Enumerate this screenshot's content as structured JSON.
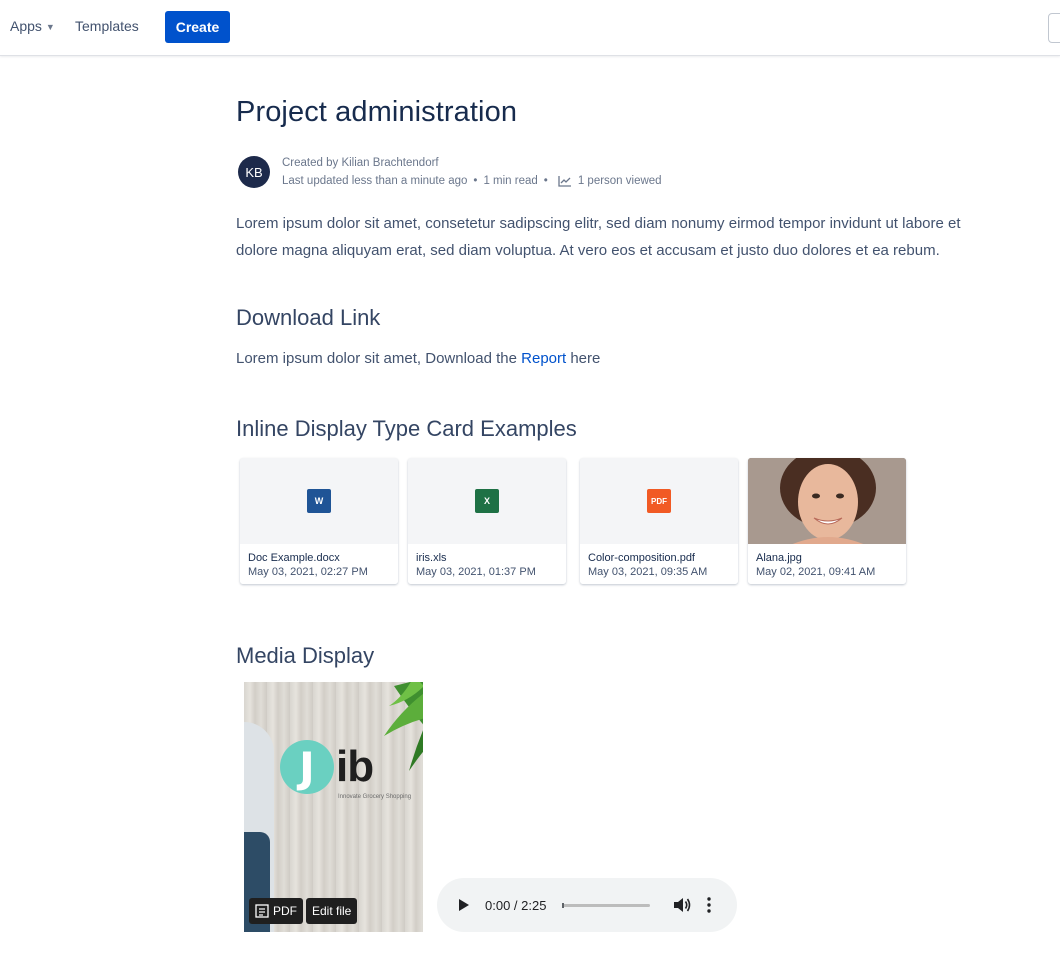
{
  "topbar": {
    "apps_label": "Apps",
    "templates_label": "Templates",
    "create_label": "Create"
  },
  "page": {
    "title": "Project administration",
    "byline": {
      "initials": "KB",
      "created_by": "Created by Kilian Brachtendorf",
      "last_updated": "Last updated less than a minute ago",
      "read_time": "1 min read",
      "views": "1 person viewed"
    },
    "intro": "Lorem ipsum dolor sit amet, consetetur sadipscing elitr, sed diam nonumy eirmod tempor invidunt ut labore et dolore magna aliquyam erat, sed diam voluptua. At vero eos et accusam et justo duo dolores et ea rebum."
  },
  "download": {
    "heading": "Download Link",
    "prefix": "Lorem ipsum dolor sit amet, Download the",
    "link_text": "Report",
    "suffix": "here"
  },
  "cards": {
    "heading": "Inline Display Type Card Examples",
    "items": [
      {
        "name": "Doc Example.docx",
        "date": "May 03, 2021, 02:27 PM",
        "icon": "word-icon",
        "icon_text": "W",
        "color": "#1f5496"
      },
      {
        "name": "iris.xls",
        "date": "May 03, 2021, 01:37 PM",
        "icon": "excel-icon",
        "icon_text": "X",
        "color": "#1e7145"
      },
      {
        "name": "Color-composition.pdf",
        "date": "May 03, 2021, 09:35 AM",
        "icon": "pdf-icon",
        "icon_text": "PDF",
        "color": "#f15a24"
      },
      {
        "name": "Alana.jpg",
        "date": "May 02, 2021, 09:41 AM",
        "icon": "photo-thumbnail",
        "icon_text": "",
        "color": "#a89a92"
      }
    ]
  },
  "media": {
    "heading": "Media Display",
    "pdf": {
      "logo_j": "J",
      "logo_rest": "ib",
      "tagline": "Innovate Grocery Shopping",
      "pdf_label": "PDF",
      "edit_label": "Edit file"
    },
    "audio": {
      "time": "0:00 / 2:25",
      "progress": 0
    }
  },
  "colors": {
    "primary": "#0052cc",
    "heading": "#172b4d",
    "body": "#42526e"
  }
}
